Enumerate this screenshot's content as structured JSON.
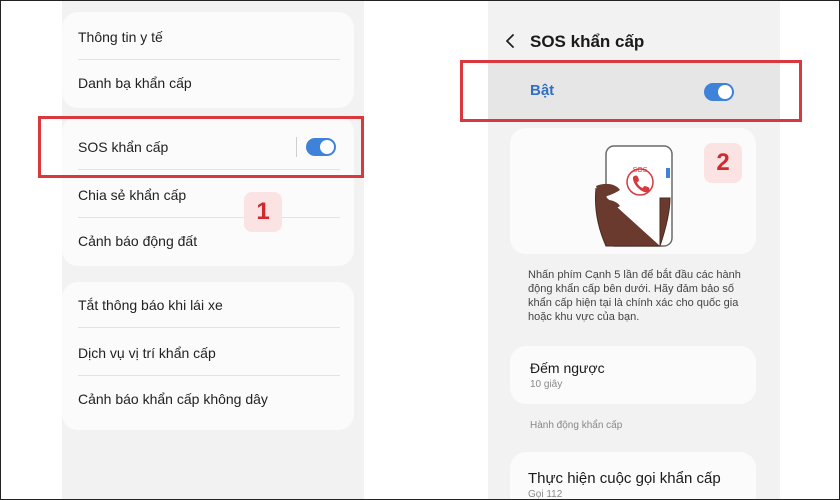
{
  "left_screen": {
    "group_1": [
      "Thông tin y tế",
      "Danh bạ khẩn cấp"
    ],
    "group_2": {
      "sos_label": "SOS khẩn cấp",
      "items": [
        "Chia sẻ khẩn cấp",
        "Cảnh báo động đất"
      ]
    },
    "group_3": [
      "Tắt thông báo khi lái xe",
      "Dịch vụ vị trí khẩn cấp",
      "Cảnh báo khẩn cấp không dây"
    ],
    "sos_toggle_on": true
  },
  "right_screen": {
    "title": "SOS khẩn cấp",
    "toggle_label": "Bật",
    "toggle_on": true,
    "illustration_text": "SOS",
    "description": "Nhấn phím Cạnh 5 lần để bắt đầu các hành động khẩn cấp bên dưới. Hãy đảm bảo số khẩn cấp hiện tại là chính xác cho quốc gia hoặc khu vực của bạn.",
    "countdown": {
      "title": "Đếm ngược",
      "value": "10 giây"
    },
    "section_label": "Hành động khẩn cấp",
    "emergency_call": {
      "title": "Thực hiện cuộc gọi khẩn cấp",
      "value": "Gọi 112"
    }
  },
  "annotations": {
    "step_1": "1",
    "step_2": "2"
  },
  "colors": {
    "highlight_red": "#d9383f",
    "toggle_blue": "#3e82d9",
    "badge_bg": "#fbe3e4"
  }
}
